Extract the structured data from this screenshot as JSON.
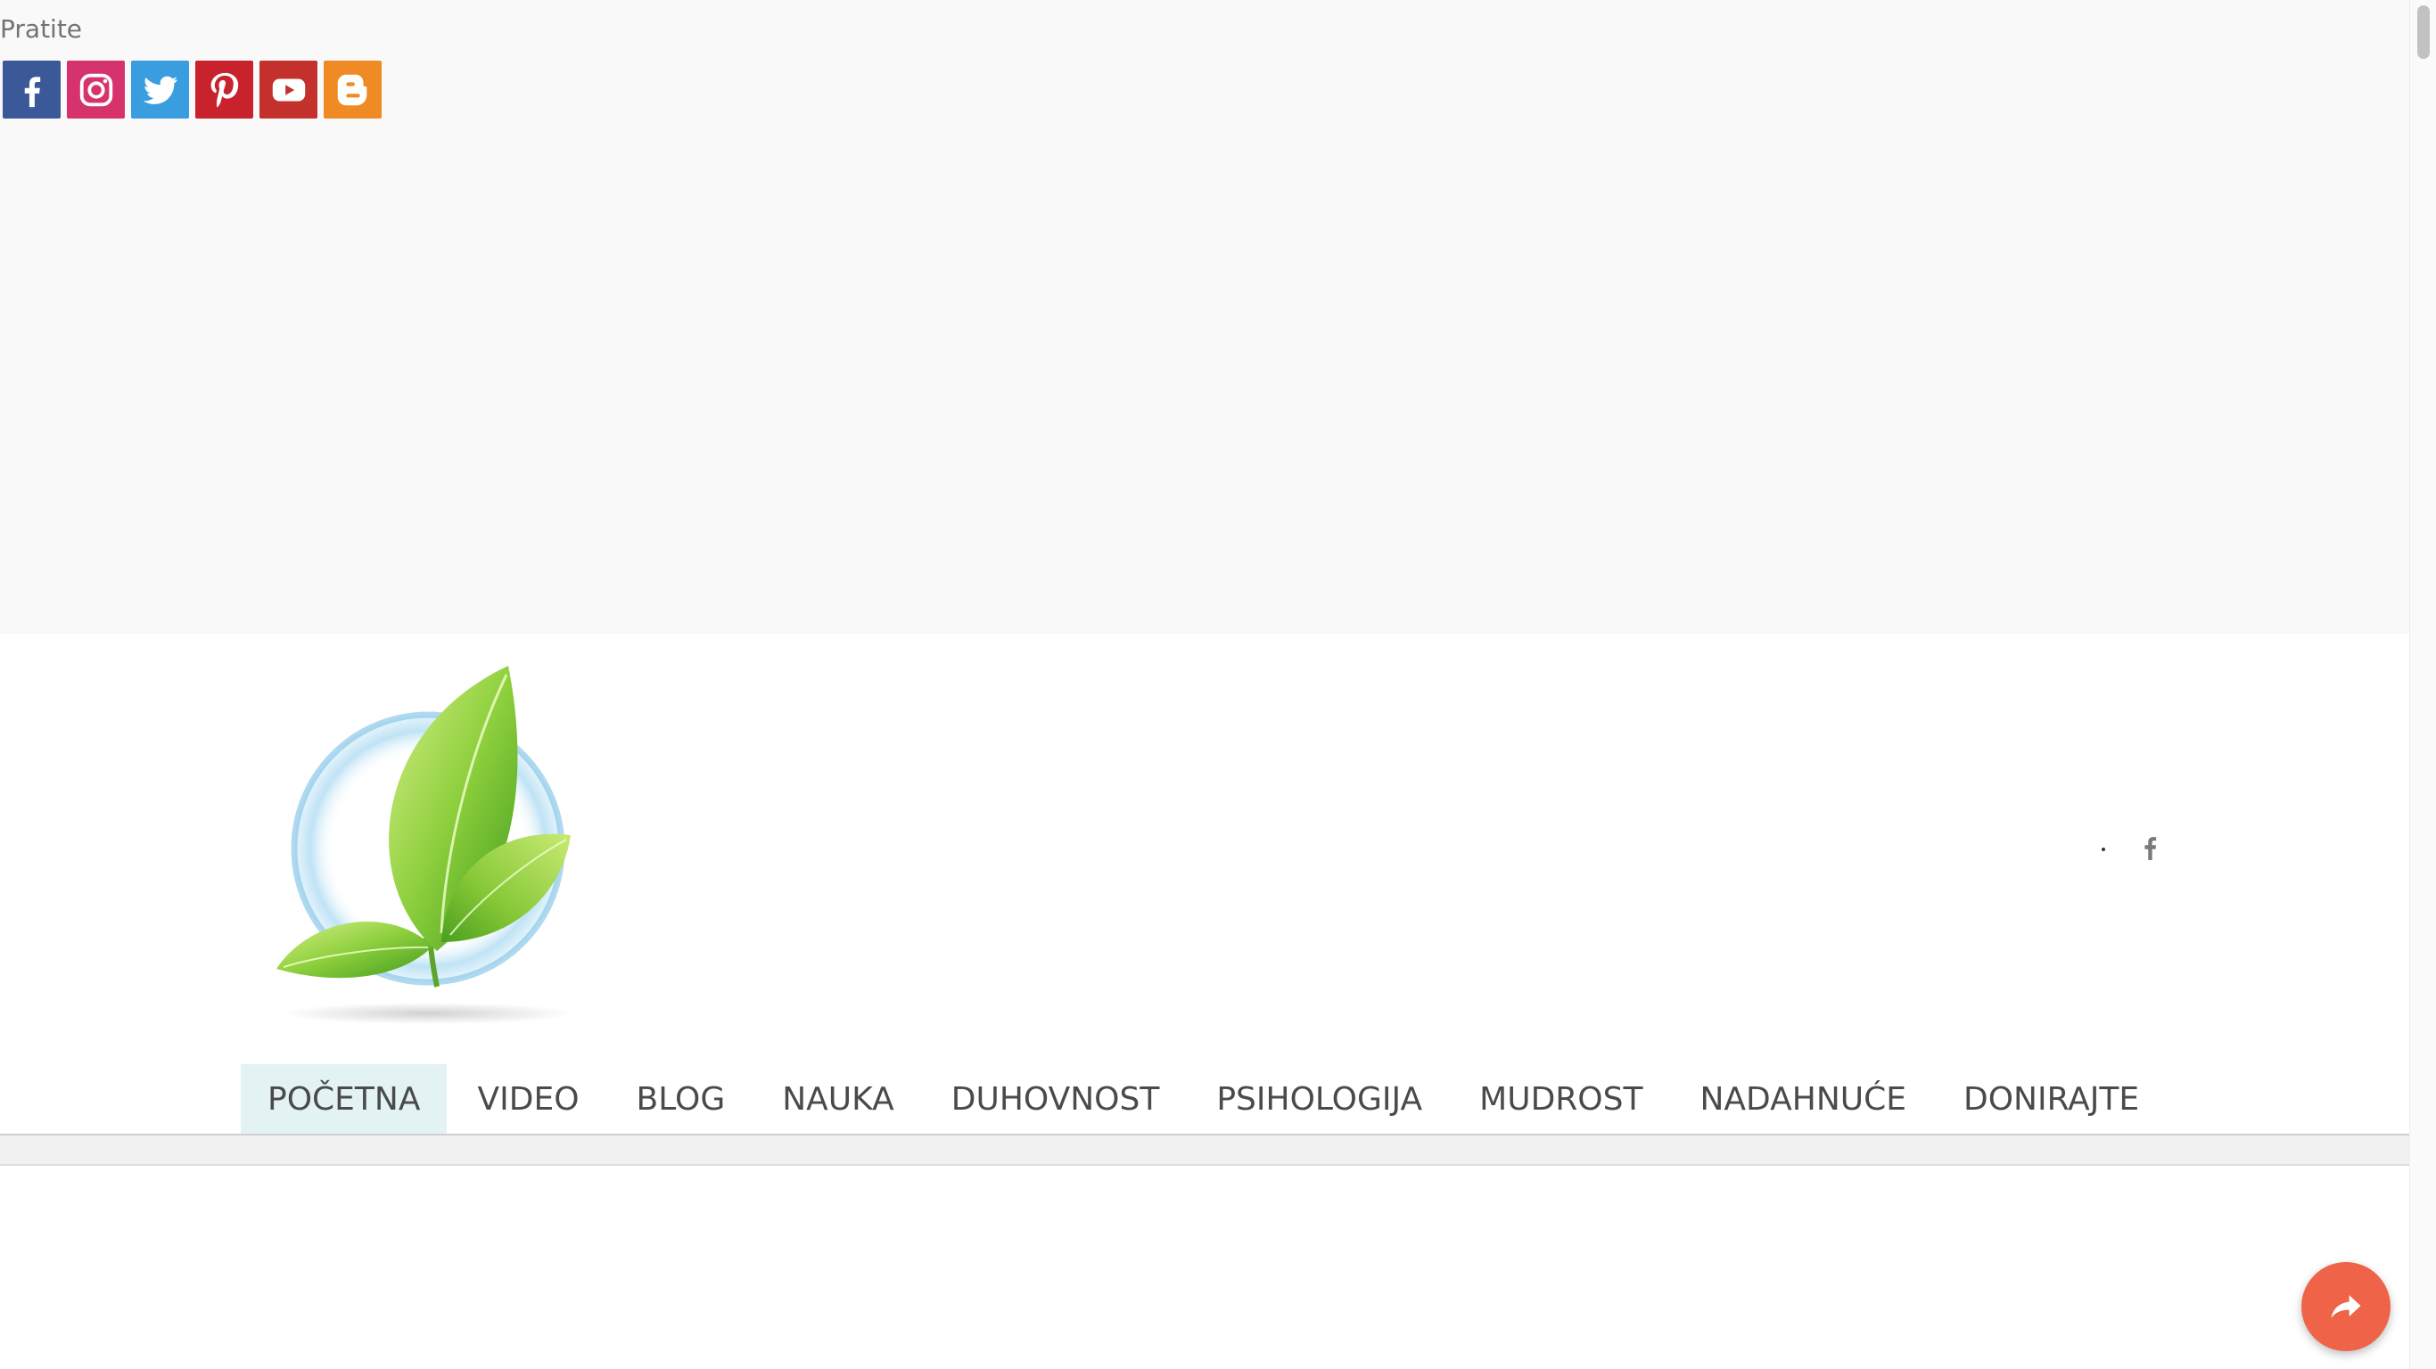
{
  "follow": {
    "label": "Pratite",
    "icons": [
      {
        "name": "facebook-icon",
        "color": "#3b5998"
      },
      {
        "name": "instagram-icon",
        "color": "#d6336c"
      },
      {
        "name": "twitter-icon",
        "color": "#3a9de0"
      },
      {
        "name": "pinterest-icon",
        "color": "#c8232c"
      },
      {
        "name": "youtube-icon",
        "color": "#c4302b"
      },
      {
        "name": "blogger-icon",
        "color": "#f08a24"
      }
    ]
  },
  "header": {
    "logo": "green-leaf-logo",
    "dot": ".",
    "small_icon": "facebook-icon"
  },
  "nav": {
    "items": [
      {
        "label": "POČETNA",
        "active": true
      },
      {
        "label": "VIDEO"
      },
      {
        "label": "BLOG"
      },
      {
        "label": "NAUKA"
      },
      {
        "label": "DUHOVNOST"
      },
      {
        "label": "PSIHOLOGIJA"
      },
      {
        "label": "MUDROST"
      },
      {
        "label": "NADAHNUĆE"
      },
      {
        "label": "DONIRAJTE"
      }
    ],
    "active_bg": "#e3f3f4"
  },
  "share": {
    "icon": "share-arrow-icon",
    "color": "#ef6449"
  }
}
